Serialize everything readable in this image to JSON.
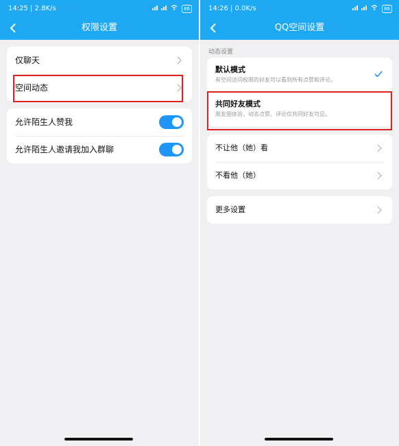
{
  "left": {
    "status_time": "14:25 | 2.8K/s",
    "status_battery": "86",
    "title": "权限设置",
    "rows": [
      {
        "label": "仅聊天"
      },
      {
        "label": "空间动态"
      }
    ],
    "toggles": [
      {
        "label": "允许陌生人赞我",
        "on": true
      },
      {
        "label": "允许陌生人邀请我加入群聊",
        "on": true
      }
    ]
  },
  "right": {
    "status_time": "14:26 | 0.0K/s",
    "status_battery": "86",
    "title": "QQ空间设置",
    "section_label": "动态设置",
    "modes": [
      {
        "title": "默认模式",
        "desc": "有空间访问权限的好友可以看到所有点赞和评论。",
        "selected": true
      },
      {
        "title": "共同好友模式",
        "desc": "朋友圈体验，动态点赞、评论仅共同好友可见。",
        "selected": false
      }
    ],
    "rows": [
      {
        "label": "不让他（她）看"
      },
      {
        "label": "不看他（她）"
      }
    ],
    "more": {
      "label": "更多设置"
    }
  },
  "colors": {
    "header": "#1fa8f2",
    "toggle_on": "#1e96f5",
    "highlight": "#e21f1f",
    "check": "#1e96f5"
  }
}
